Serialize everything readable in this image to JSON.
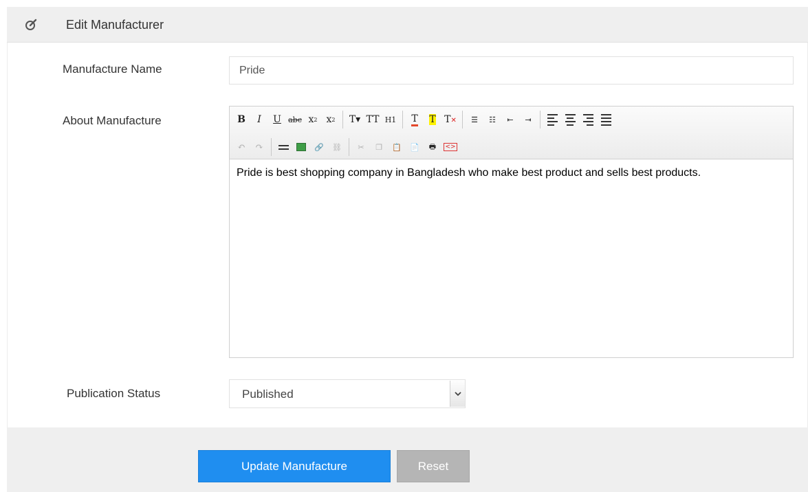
{
  "header": {
    "title": "Edit Manufacturer",
    "icon": "edit-icon"
  },
  "form": {
    "name_label": "Manufacture Name",
    "name_value": "Pride",
    "about_label": "About Manufacture",
    "about_text": "Pride is best shopping company in Bangladesh who make best product and sells best products.",
    "status_label": "Publication Status",
    "status_value": "Published"
  },
  "editor_toolbar": {
    "row1": [
      "bold",
      "italic",
      "underline",
      "strikethrough",
      "subscript",
      "superscript",
      "font-size",
      "font-family",
      "heading",
      "text-color",
      "highlight",
      "remove-format",
      "unordered-list",
      "ordered-list",
      "outdent",
      "indent",
      "align-left",
      "align-center",
      "align-right",
      "justify"
    ],
    "row2": [
      "undo",
      "redo",
      "horizontal-rule",
      "image",
      "link",
      "unlink",
      "cut",
      "copy",
      "paste",
      "paste-text",
      "print",
      "source"
    ]
  },
  "actions": {
    "update_label": "Update Manufacture",
    "reset_label": "Reset"
  },
  "colors": {
    "primary": "#1f8ef0",
    "reset": "#b5b5b5",
    "panel_bg": "#efefef"
  }
}
